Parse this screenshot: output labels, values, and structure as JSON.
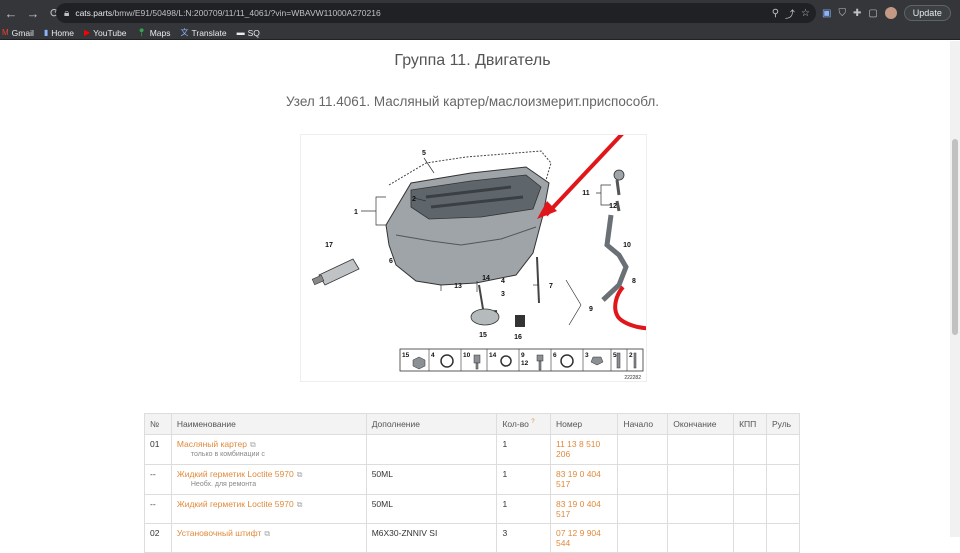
{
  "browser": {
    "url_host": "cats.parts",
    "url_path": "/bmw/E91/50498/L:N:200709/11/11_4061/?vin=WBAVW11000A270216",
    "update_label": "Update",
    "bookmarks": [
      {
        "label": "Gmail",
        "icon": "gmail-icon"
      },
      {
        "label": "Home",
        "icon": "bookmark-icon"
      },
      {
        "label": "YouTube",
        "icon": "youtube-icon"
      },
      {
        "label": "Maps",
        "icon": "maps-icon"
      },
      {
        "label": "Translate",
        "icon": "translate-icon"
      },
      {
        "label": "SQ",
        "icon": "folder-icon"
      }
    ]
  },
  "page": {
    "group_title": "Группа 11. Двигатель",
    "node_title": "Узел 11.4061. Масляный картер/маслоизмерит.приспособл."
  },
  "diagram": {
    "callouts": [
      "1",
      "2",
      "3",
      "4",
      "5",
      "6",
      "7",
      "8",
      "9",
      "10",
      "11",
      "12",
      "13",
      "14",
      "15",
      "16",
      "17"
    ],
    "legend_labels": [
      "15",
      "4",
      "10",
      "14",
      "9",
      "12",
      "6",
      "3",
      "5",
      "2"
    ],
    "code": "222282"
  },
  "table": {
    "headers": [
      "№",
      "Наименование",
      "Дополнение",
      "Кол-во",
      "Номер",
      "Начало",
      "Окончание",
      "КПП",
      "Руль"
    ],
    "qty_help": "?",
    "rows": [
      {
        "no": "01",
        "name": "Масляный картер",
        "note": "только в комбинации с",
        "extra": "",
        "qty": "1",
        "number": "11 13 8 510 206"
      },
      {
        "no": "--",
        "name": "Жидкий герметик Loctite 5970",
        "note": "Необх. для ремонта",
        "extra": "50ML",
        "qty": "1",
        "number": "83 19 0 404 517"
      },
      {
        "no": "--",
        "name": "Жидкий герметик Loctite 5970",
        "note": "",
        "extra": "50ML",
        "qty": "1",
        "number": "83 19 0 404 517"
      },
      {
        "no": "02",
        "name": "Установочный штифт",
        "note": "",
        "extra": "M6X30-ZNNIV SI",
        "qty": "3",
        "number": "07 12 9 904 544"
      }
    ]
  }
}
